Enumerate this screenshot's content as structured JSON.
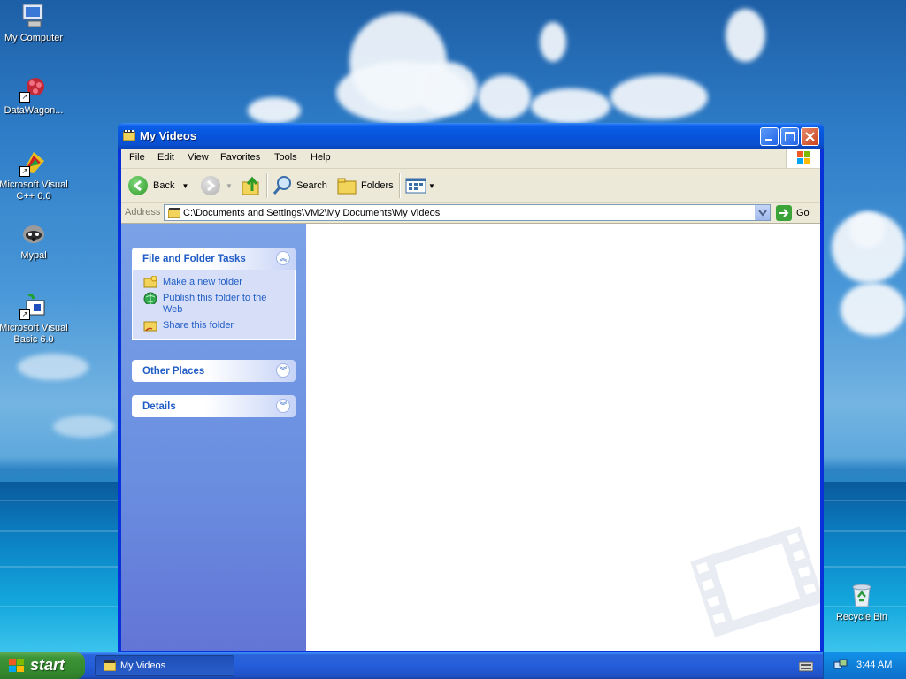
{
  "desktop": {
    "icons": [
      {
        "label": "My Computer"
      },
      {
        "label": "DataWagon..."
      },
      {
        "label": "Microsoft Visual C++ 6.0"
      },
      {
        "label": "Mypal"
      },
      {
        "label": "Microsoft Visual Basic 6.0"
      },
      {
        "label": "Recycle Bin"
      }
    ]
  },
  "window": {
    "title": "My Videos",
    "menu": [
      "File",
      "Edit",
      "View",
      "Favorites",
      "Tools",
      "Help"
    ],
    "toolbar": {
      "back_label": "Back",
      "search_label": "Search",
      "folders_label": "Folders"
    },
    "address": {
      "label": "Address",
      "value": "C:\\Documents and Settings\\VM2\\My Documents\\My Videos",
      "go_label": "Go"
    },
    "tasks": {
      "file_folder": {
        "title": "File and Folder Tasks",
        "links": [
          "Make a new folder",
          "Publish this folder to the Web",
          "Share this folder"
        ]
      },
      "other_places": {
        "title": "Other Places"
      },
      "details": {
        "title": "Details"
      }
    }
  },
  "taskbar": {
    "start_label": "start",
    "items": [
      {
        "label": "My Videos"
      }
    ],
    "clock": "3:44 AM"
  },
  "colors": {
    "titlebar": "#0654dc",
    "task_pane": "#6a8ee0",
    "link": "#215dc6",
    "start_green": "#3c9436"
  }
}
